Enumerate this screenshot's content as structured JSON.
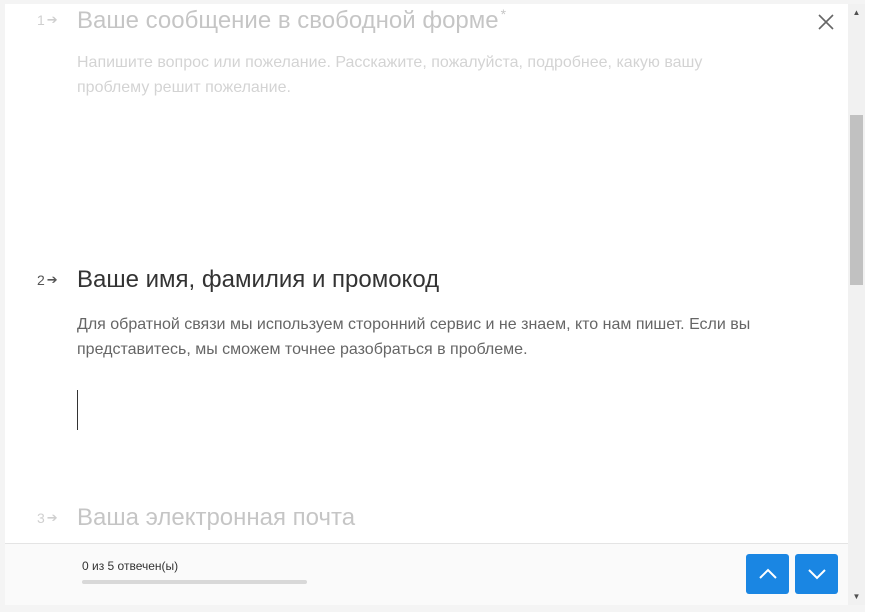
{
  "questions": [
    {
      "number": "1",
      "title": "Ваше сообщение в свободной форме",
      "required_mark": "*",
      "description": "Напишите вопрос или пожелание. Расскажите, пожалуйста, подробнее, какую вашу проблему решит пожелание."
    },
    {
      "number": "2",
      "title": "Ваше имя, фамилия и промокод",
      "description": "Для обратной связи мы используем сторонний сервис и не знаем, кто нам пишет. Если вы представитесь, мы сможем точнее разобраться в проблеме."
    },
    {
      "number": "3",
      "title": "Ваша электронная почта"
    }
  ],
  "footer": {
    "progress_text": "0 из 5 отвечен(ы)",
    "progress_fraction": 0
  },
  "colors": {
    "accent": "#1a86e3",
    "text": "#333333"
  }
}
